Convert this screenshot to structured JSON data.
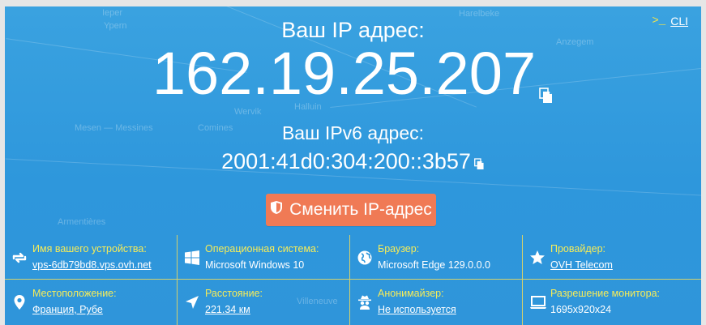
{
  "cli": {
    "label": "CLI",
    "prompt": ">_"
  },
  "ip": {
    "title": "Ваш IP адрес:",
    "value": "162.19.25.207"
  },
  "ipv6": {
    "title": "Ваш IPv6 адрес:",
    "value": "2001:41d0:304:200::3b57"
  },
  "change_button": {
    "label": "Сменить IP-адрес"
  },
  "info": [
    {
      "label": "Имя вашего устройства:",
      "value": "vps-6db79bd8.vps.ovh.net",
      "icon": "refresh-icon"
    },
    {
      "label": "Операционная система:",
      "value": "Microsoft Windows 10",
      "icon": "windows-icon"
    },
    {
      "label": "Браузер:",
      "value": "Microsoft Edge 129.0.0.0",
      "icon": "globe-icon"
    },
    {
      "label": "Провайдер:",
      "value": "OVH Telecom",
      "icon": "star-icon"
    },
    {
      "label": "Местоположение:",
      "value": "Франция, Рубе",
      "icon": "location-pin-icon"
    },
    {
      "label": "Расстояние:",
      "value": "221.34 км",
      "icon": "navigation-arrow-icon"
    },
    {
      "label": "Анонимайзер:",
      "value": "Не используется",
      "icon": "spy-icon"
    },
    {
      "label": "Разрешение монитора:",
      "value": "1695x920x24",
      "icon": "monitor-icon"
    }
  ],
  "colors": {
    "panel": "#3aa2e0",
    "label_yellow": "#f6ec58",
    "button": "#f07a55"
  }
}
